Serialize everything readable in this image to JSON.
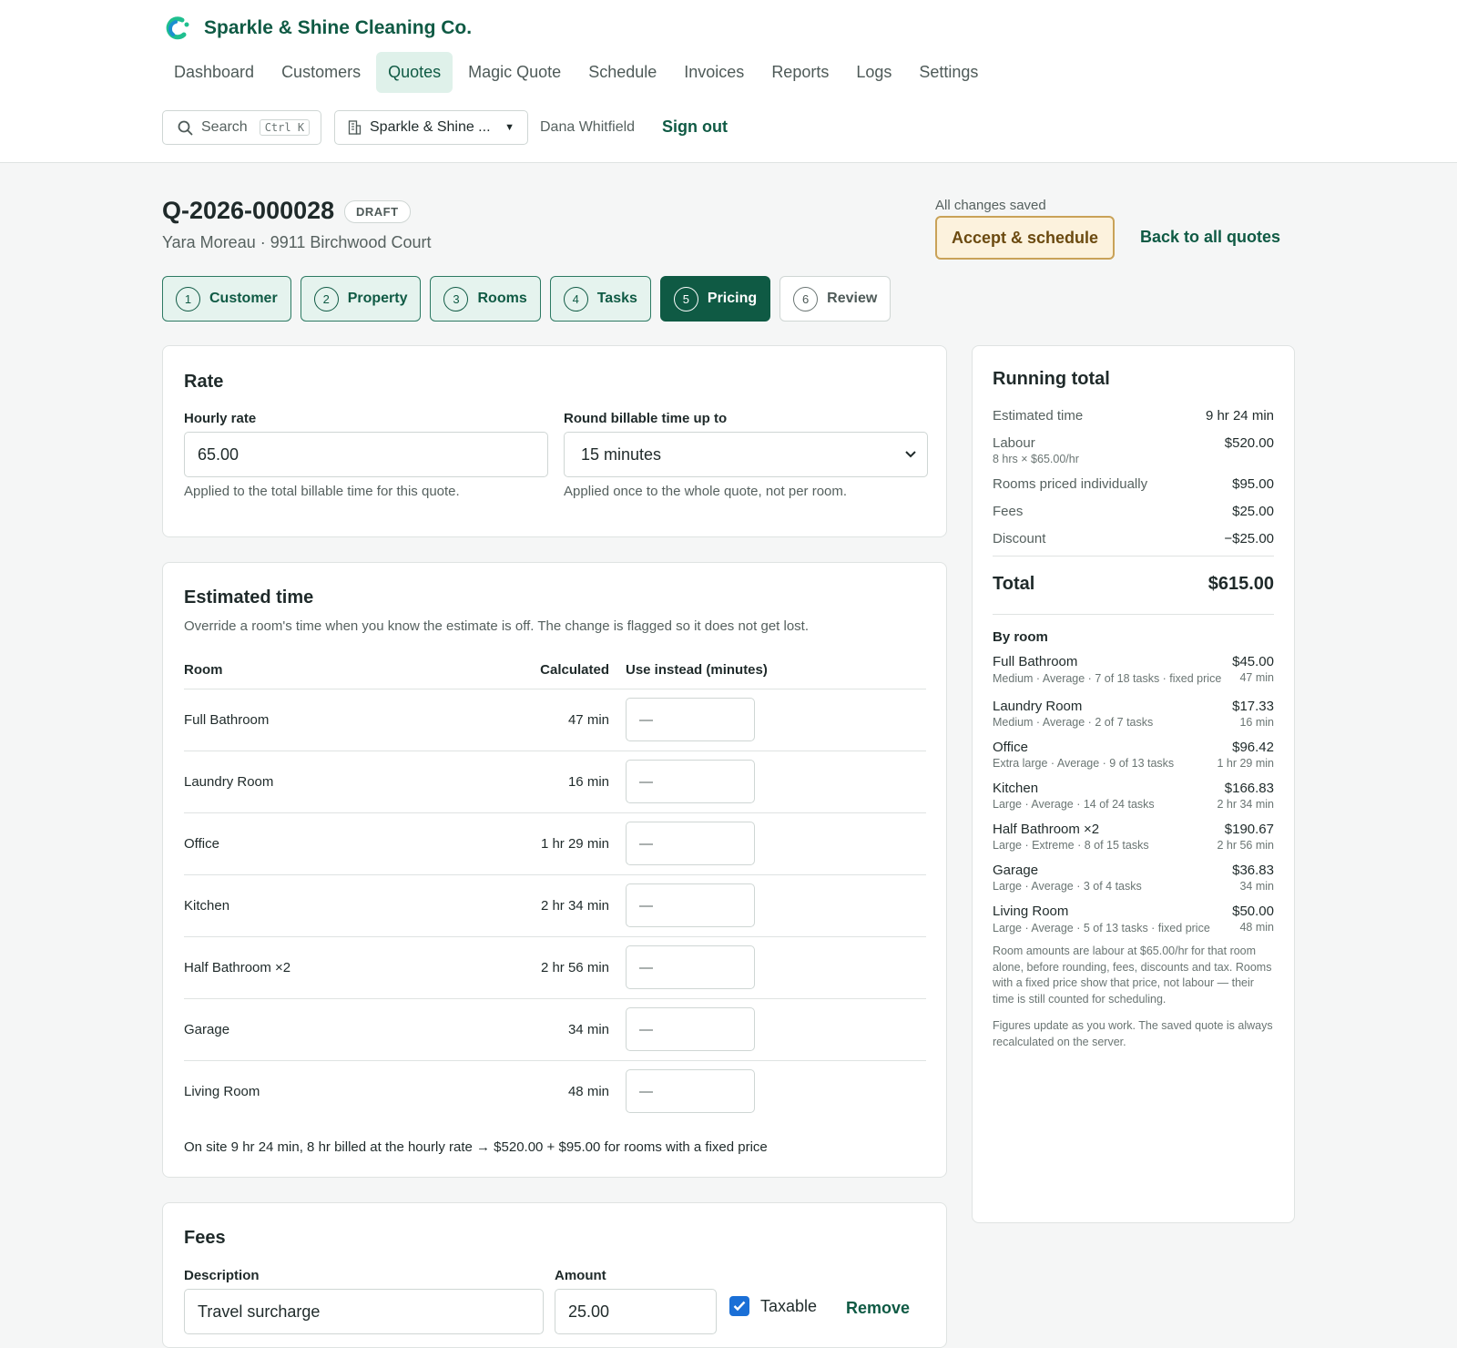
{
  "app": {
    "name": "Sparkle & Shine Cleaning Co.",
    "brand_color": "#0f5a44",
    "accent_color": "#1fbf8f"
  },
  "nav": {
    "items": [
      {
        "label": "Dashboard",
        "active": false
      },
      {
        "label": "Customers",
        "active": false
      },
      {
        "label": "Quotes",
        "active": true
      },
      {
        "label": "Magic Quote",
        "active": false
      },
      {
        "label": "Schedule",
        "active": false
      },
      {
        "label": "Invoices",
        "active": false
      },
      {
        "label": "Reports",
        "active": false
      },
      {
        "label": "Logs",
        "active": false
      },
      {
        "label": "Settings",
        "active": false
      }
    ]
  },
  "toolbar": {
    "search_label": "Search",
    "search_shortcut": "Ctrl K",
    "org_selected": "Sparkle & Shine ...",
    "user_name": "Dana Whitfield",
    "sign_out": "Sign out"
  },
  "quote": {
    "id": "Q-2026-000028",
    "status": "DRAFT",
    "subtitle": "Yara Moreau · 9911 Birchwood Court",
    "save_status": "All changes saved",
    "accept_label": "Accept & schedule",
    "back_label": "Back to all quotes"
  },
  "steps": [
    {
      "num": "1",
      "label": "Customer",
      "state": "done"
    },
    {
      "num": "2",
      "label": "Property",
      "state": "done"
    },
    {
      "num": "3",
      "label": "Rooms",
      "state": "done"
    },
    {
      "num": "4",
      "label": "Tasks",
      "state": "done"
    },
    {
      "num": "5",
      "label": "Pricing",
      "state": "current"
    },
    {
      "num": "6",
      "label": "Review",
      "state": "future"
    }
  ],
  "rate": {
    "title": "Rate",
    "hourly_label": "Hourly rate",
    "hourly_value": "65.00",
    "hourly_help": "Applied to the total billable time for this quote.",
    "round_label": "Round billable time up to",
    "round_value": "15 minutes",
    "round_help": "Applied once to the whole quote, not per room."
  },
  "estimated": {
    "title": "Estimated time",
    "description": "Override a room's time when you know the estimate is off. The change is flagged so it does not get lost.",
    "col_room": "Room",
    "col_calculated": "Calculated",
    "col_override": "Use instead (minutes)",
    "rows": [
      {
        "room": "Full Bathroom",
        "calculated": "47 min",
        "override": "—"
      },
      {
        "room": "Laundry Room",
        "calculated": "16 min",
        "override": "—"
      },
      {
        "room": "Office",
        "calculated": "1 hr 29 min",
        "override": "—"
      },
      {
        "room": "Kitchen",
        "calculated": "2 hr 34 min",
        "override": "—"
      },
      {
        "room": "Half Bathroom ×2",
        "calculated": "2 hr 56 min",
        "override": "—"
      },
      {
        "room": "Garage",
        "calculated": "34 min",
        "override": "—"
      },
      {
        "room": "Living Room",
        "calculated": "48 min",
        "override": "—"
      }
    ],
    "summary": "On site 9 hr 24 min, 8 hr billed at the hourly rate → $520.00 + $95.00 for rooms with a fixed price"
  },
  "fees": {
    "title": "Fees",
    "col_description": "Description",
    "col_amount": "Amount",
    "rows": [
      {
        "description": "Travel surcharge",
        "amount": "25.00",
        "taxable_label": "Taxable",
        "taxable": true,
        "remove_label": "Remove"
      }
    ]
  },
  "running_total": {
    "title": "Running total",
    "estimated_time_label": "Estimated time",
    "estimated_time": "9 hr 24 min",
    "labour_label": "Labour",
    "labour_sub": "8 hrs × $65.00/hr",
    "labour": "$520.00",
    "rooms_fixed_label": "Rooms priced individually",
    "rooms_fixed": "$95.00",
    "fees_label": "Fees",
    "fees": "$25.00",
    "discount_label": "Discount",
    "discount": "−$25.00",
    "total_label": "Total",
    "total": "$615.00",
    "by_room_label": "By room",
    "rooms": [
      {
        "name": "Full Bathroom",
        "detail": "Medium · Average · 7 of 18 tasks · fixed price",
        "amount": "$45.00",
        "time": "47 min"
      },
      {
        "name": "Laundry Room",
        "detail": "Medium · Average · 2 of 7 tasks",
        "amount": "$17.33",
        "time": "16 min"
      },
      {
        "name": "Office",
        "detail": "Extra large · Average · 9 of 13 tasks",
        "amount": "$96.42",
        "time": "1 hr 29 min"
      },
      {
        "name": "Kitchen",
        "detail": "Large · Average · 14 of 24 tasks",
        "amount": "$166.83",
        "time": "2 hr 34 min"
      },
      {
        "name": "Half Bathroom ×2",
        "detail": "Large · Extreme · 8 of 15 tasks",
        "amount": "$190.67",
        "time": "2 hr 56 min"
      },
      {
        "name": "Garage",
        "detail": "Large · Average · 3 of 4 tasks",
        "amount": "$36.83",
        "time": "34 min"
      },
      {
        "name": "Living Room",
        "detail": "Large · Average · 5 of 13 tasks · fixed price",
        "amount": "$50.00",
        "time": "48 min"
      }
    ],
    "note1": "Room amounts are labour at $65.00/hr for that room alone, before rounding, fees, discounts and tax. Rooms with a fixed price show that price, not labour — their time is still counted for scheduling.",
    "note2": "Figures update as you work. The saved quote is always recalculated on the server."
  }
}
